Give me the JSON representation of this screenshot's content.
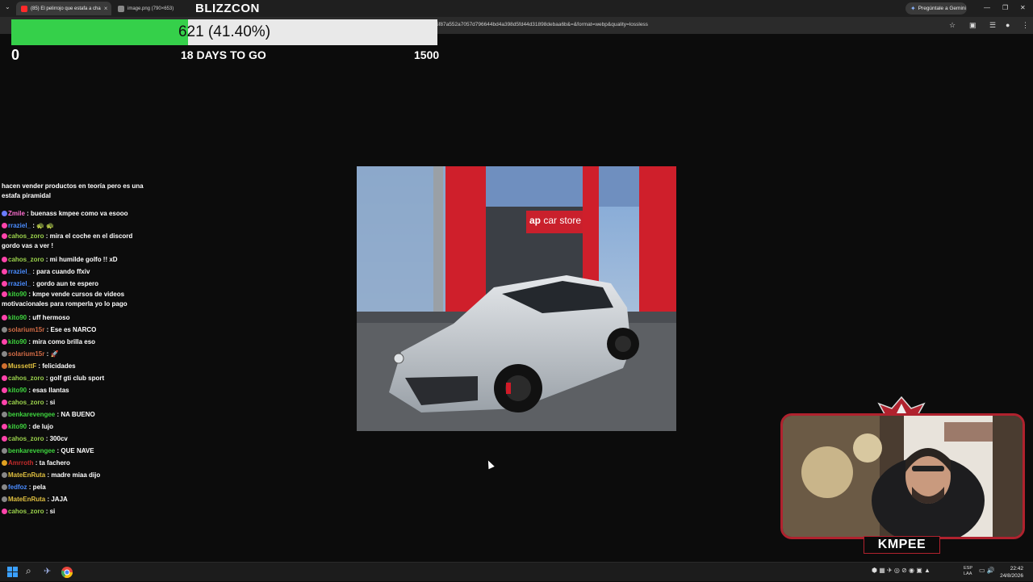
{
  "browser": {
    "tabs": [
      {
        "label": "(85) El pelirrojo que estafa a cha",
        "active": true
      },
      {
        "label": "image.png (790×653)",
        "active": false
      }
    ],
    "url": "5f87a552a7057d796644bd4a398d5fd44d31898debaa6b&=&format=webp&quality=lossless",
    "gemini_label": "Pregúntale a Gemini"
  },
  "overlay": {
    "brand": "BLIZZCON",
    "goal_text": "621 (41.40%)",
    "goal_progress": 0.414,
    "goal_min": "0",
    "days_label": "18 DAYS TO GO",
    "goal_max": "1500"
  },
  "chat": {
    "messages": [
      {
        "user": "",
        "text": "hacen vender productos en teoría pero es una estafa piramidal",
        "color": "#ffffff",
        "badge": ""
      },
      {
        "user": "Zmile",
        "text": ": buenass kmpee como va esooo",
        "color": "#ff6fd0",
        "badge": "#6a7cff"
      },
      {
        "user": "rraziel_",
        "text": ": 🐢 🐢",
        "color": "#4a8cff",
        "badge": "#ff44aa"
      },
      {
        "user": "cahos_zoro",
        "text": ": mira el coche en el discord gordo vas a ver !",
        "color": "#9ad14b",
        "badge": "#ff44aa"
      },
      {
        "user": "cahos_zoro",
        "text": ": mi humilde golfo !! xD",
        "color": "#9ad14b",
        "badge": "#ff44aa"
      },
      {
        "user": "rraziel_",
        "text": ": para cuando ffxiv",
        "color": "#4a8cff",
        "badge": "#ff44aa"
      },
      {
        "user": "rraziel_",
        "text": ": gordo aun te espero",
        "color": "#4a8cff",
        "badge": "#ff44aa"
      },
      {
        "user": "kito90",
        "text": ": kmpe vende cursos de videos motivacionales para romperla yo lo pago",
        "color": "#3ed43e",
        "badge": "#ff44aa"
      },
      {
        "user": "kito90",
        "text": ": uff hermoso",
        "color": "#3ed43e",
        "badge": "#ff44aa"
      },
      {
        "user": "solarium15r",
        "text": ": Ese es NARCO",
        "color": "#d06a45",
        "badge": "#888888"
      },
      {
        "user": "kito90",
        "text": ": mira como brilla eso",
        "color": "#3ed43e",
        "badge": "#ff44aa"
      },
      {
        "user": "solarium15r",
        "text": ": 🚀",
        "color": "#d06a45",
        "badge": "#888888"
      },
      {
        "user": "MussettF",
        "text": ": felicidades",
        "color": "#e0c040",
        "badge": "#d07030"
      },
      {
        "user": "cahos_zoro",
        "text": ": golf gti club sport",
        "color": "#9ad14b",
        "badge": "#ff44aa"
      },
      {
        "user": "kito90",
        "text": ": esas llantas",
        "color": "#3ed43e",
        "badge": "#ff44aa"
      },
      {
        "user": "cahos_zoro",
        "text": ": si",
        "color": "#9ad14b",
        "badge": "#ff44aa"
      },
      {
        "user": "benkarevengee",
        "text": ": NA BUENO",
        "color": "#3ed43e",
        "badge": "#888888"
      },
      {
        "user": "kito90",
        "text": ": de lujo",
        "color": "#3ed43e",
        "badge": "#ff44aa"
      },
      {
        "user": "cahos_zoro",
        "text": ": 300cv",
        "color": "#9ad14b",
        "badge": "#ff44aa"
      },
      {
        "user": "benkarevengee",
        "text": ": QUE NAVE",
        "color": "#3ed43e",
        "badge": "#888888"
      },
      {
        "user": "Amrroth",
        "text": ": ta fachero",
        "color": "#c42b2b",
        "badge": "#e0a020"
      },
      {
        "user": "MateEnRuta",
        "text": ": madre miaa dijo",
        "color": "#e0c040",
        "badge": "#888888"
      },
      {
        "user": "fedfoz",
        "text": ": pela",
        "color": "#4a8cff",
        "badge": "#888888"
      },
      {
        "user": "MateEnRuta",
        "text": ": JAJA",
        "color": "#e0c040",
        "badge": "#888888"
      },
      {
        "user": "cahos_zoro",
        "text": ": si",
        "color": "#9ad14b",
        "badge": "#ff44aa"
      }
    ]
  },
  "image": {
    "store_sign": "car store",
    "store_sign_mark": "ap"
  },
  "webcam": {
    "streamer_name": "KMPEE"
  },
  "taskbar": {
    "lang": "ESP\nLAA",
    "time": "22:42",
    "date": "24/8/2026"
  }
}
